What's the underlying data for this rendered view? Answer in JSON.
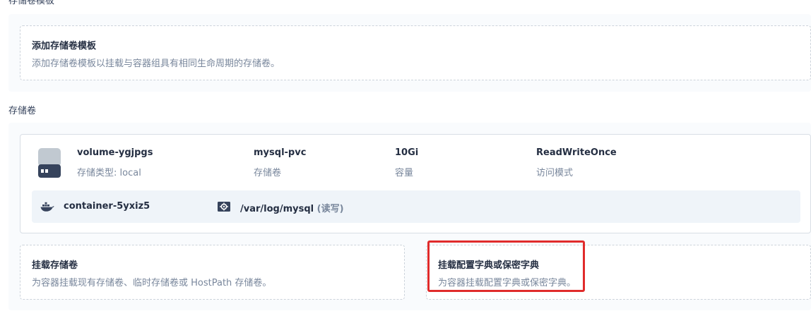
{
  "template_section": {
    "title": "存储卷模板",
    "add_card": {
      "title": "添加存储卷模板",
      "description": "添加存储卷模板以挂载与容器组具有相同生命周期的存储卷。"
    }
  },
  "volume_section": {
    "title": "存储卷",
    "volume": {
      "name": "volume-ygjpgs",
      "type_label": "存储类型: local",
      "pvc_name": "mysql-pvc",
      "pvc_label": "存储卷",
      "capacity": "10Gi",
      "capacity_label": "容量",
      "access_mode": "ReadWriteOnce",
      "access_mode_label": "访问模式",
      "mount": {
        "container_name": "container-5yxiz5",
        "mount_path": "/var/log/mysql",
        "mount_mode": "(读写)"
      }
    },
    "mount_volume_card": {
      "title": "挂载存储卷",
      "description": "为容器挂载现有存储卷、临时存储卷或 HostPath 存储卷。"
    },
    "mount_config_card": {
      "title": "挂载配置字典或保密字典",
      "description": "为容器挂载配置字典或保密字典。"
    }
  },
  "colors": {
    "highlight": "#e02b2b",
    "text_primary": "#242e42",
    "text_secondary": "#79879c",
    "panel_bg": "#f9fbfd",
    "mount_row_bg": "#eff4f9"
  },
  "icons": [
    "hard-disk-icon",
    "docker-container-icon",
    "mount-path-icon"
  ]
}
